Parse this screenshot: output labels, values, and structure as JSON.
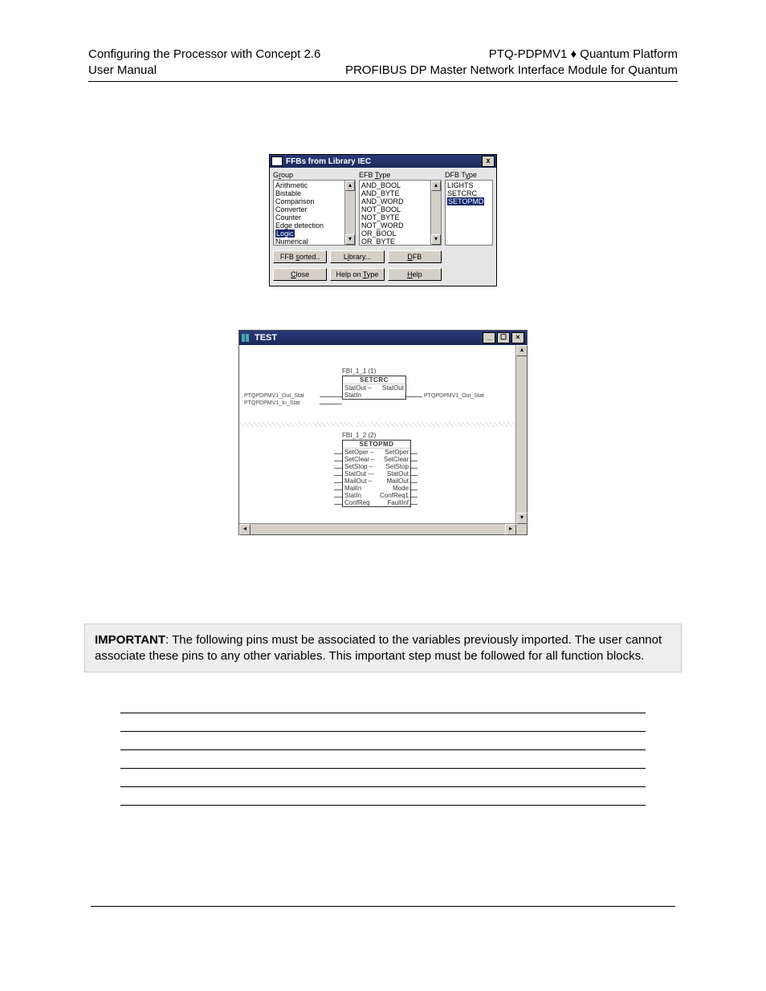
{
  "header": {
    "left_line1": "Configuring the Processor with Concept 2.6",
    "left_line2": "User Manual",
    "right_line1": "PTQ-PDPMV1 ♦ Quantum Platform",
    "right_line2": "PROFIBUS DP Master Network Interface Module for Quantum"
  },
  "dialog": {
    "title": "FFBs from Library IEC",
    "close_x": "x",
    "col_group_label_pre": "G",
    "col_group_label_u": "r",
    "col_group_label_post": "oup",
    "col_efbtype_label_pre": "EFB ",
    "col_efbtype_label_u": "T",
    "col_efbtype_label_post": "ype",
    "col_dfbtype_label_pre": "DFB T",
    "col_dfbtype_label_u": "y",
    "col_dfbtype_label_post": "pe",
    "groups": [
      "Arithmetic",
      "Bistable",
      "Comparison",
      "Converter",
      "Counter",
      "Edge detection",
      "Logic",
      "Numerical"
    ],
    "group_selected_index": 6,
    "efb_types": [
      "AND_BOOL",
      "AND_BYTE",
      "AND_WORD",
      "NOT_BOOL",
      "NOT_BYTE",
      "NOT_WORD",
      "OR_BOOL",
      "OR_BYTE"
    ],
    "dfb_types": [
      "LIGHTS",
      "SETCRC",
      "SETOPMD"
    ],
    "dfb_selected_index": 2,
    "btn_sorted_pre": "FFB ",
    "btn_sorted_u": "s",
    "btn_sorted_post": "orted..",
    "btn_library_pre": "L",
    "btn_library_u": "i",
    "btn_library_post": "brary...",
    "btn_dfb_pre": "",
    "btn_dfb_u": "D",
    "btn_dfb_post": "FB",
    "btn_close_pre": "",
    "btn_close_u": "C",
    "btn_close_post": "lose",
    "btn_helptype_pre": "Help on ",
    "btn_helptype_u": "T",
    "btn_helptype_post": "ype",
    "btn_help_pre": "",
    "btn_help_u": "H",
    "btn_help_post": "elp"
  },
  "testwin": {
    "title": "TEST",
    "min": "_",
    "max": "☐",
    "close": "×",
    "block1": {
      "inst": "FBI_1_1 (1)",
      "type": "SETCRC",
      "row1_l": "StatOut",
      "row1_sep": "–",
      "row1_r": "StatOut",
      "row2_l": "StatIn",
      "in1": "PTQPDPMV1_Out_Stat",
      "in2": "PTQPDPMV1_In_Stat",
      "out1": "PTQPDPMV1_Out_Stat"
    },
    "block2": {
      "inst": "FBI_1_2 (2)",
      "type": "SETOPMD",
      "rows": [
        {
          "l": "SetOper",
          "r": "SetOper",
          "sep": "–"
        },
        {
          "l": "SetClear",
          "r": "SetClear",
          "sep": "–"
        },
        {
          "l": "SetStop",
          "r": "SetStop",
          "sep": "–"
        },
        {
          "l": "StatOut",
          "r": "StatOut",
          "sep": "---"
        },
        {
          "l": "MailOut",
          "r": "MailOut",
          "sep": "–"
        },
        {
          "l": "MailIn",
          "r": "Mode",
          "sep": ""
        },
        {
          "l": "StatIn",
          "r": "ConfReq1",
          "sep": ""
        },
        {
          "l": "ConfReq",
          "r": "FaultInf",
          "sep": ""
        }
      ]
    }
  },
  "important": {
    "label": "IMPORTANT",
    "text": ": The following pins must be associated to the variables previously imported. The user cannot associate these pins to any other variables. This important step must be followed for all function blocks."
  }
}
